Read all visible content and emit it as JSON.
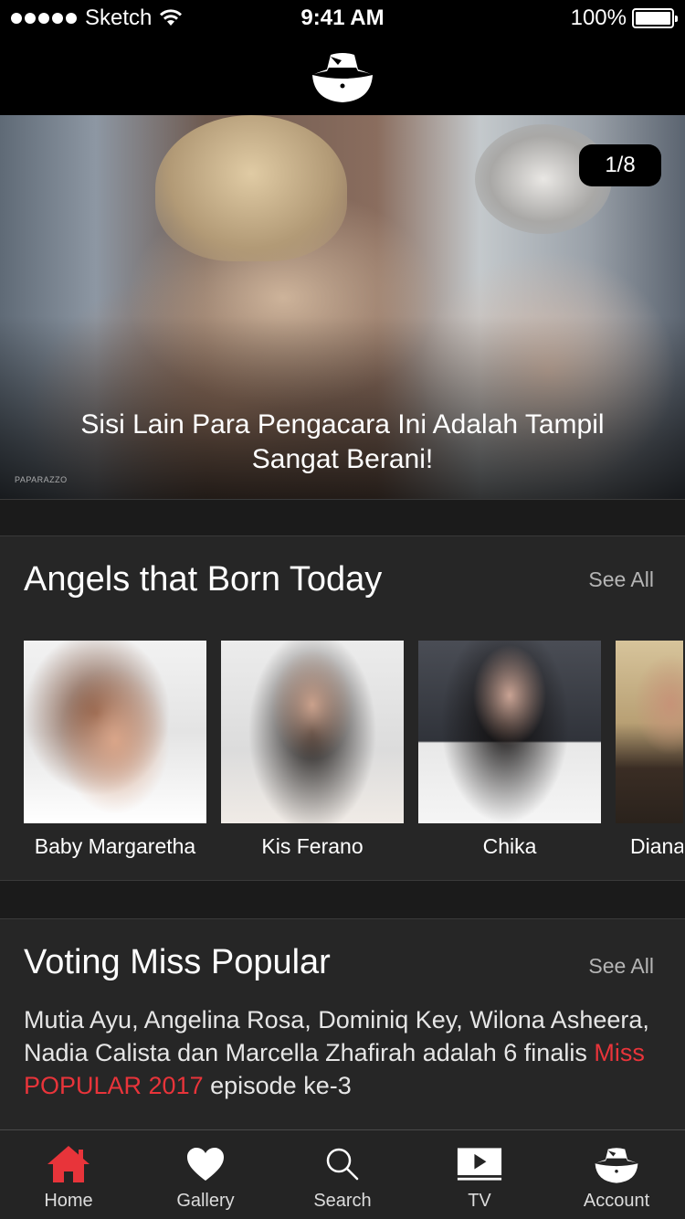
{
  "status_bar": {
    "carrier": "Sketch",
    "time": "9:41 AM",
    "battery": "100%"
  },
  "header": {
    "logo_icon": "hat-logo-icon"
  },
  "hero": {
    "counter": "1/8",
    "title": "Sisi Lain Para Pengacara Ini Adalah Tampil Sangat Berani!",
    "watermark": "PAPARAZZO"
  },
  "angels": {
    "title": "Angels that Born Today",
    "see_all": "See All",
    "items": [
      {
        "name": "Baby Margaretha"
      },
      {
        "name": "Kis Ferano"
      },
      {
        "name": "Chika"
      },
      {
        "name": "Diana"
      }
    ]
  },
  "voting": {
    "title": "Voting Miss Popular",
    "see_all": "See All",
    "text_before": "Mutia Ayu, Angelina Rosa, Dominiq Key, Wilona Asheera, Nadia Calista dan Marcella Zhafirah adalah 6 finalis ",
    "highlight": "Miss POPULAR 2017",
    "text_after": " episode ke-3"
  },
  "tabs": [
    {
      "label": "Home",
      "icon": "home-icon",
      "active": true
    },
    {
      "label": "Gallery",
      "icon": "heart-icon",
      "active": false
    },
    {
      "label": "Search",
      "icon": "search-icon",
      "active": false
    },
    {
      "label": "TV",
      "icon": "play-tv-icon",
      "active": false
    },
    {
      "label": "Account",
      "icon": "hat-account-icon",
      "active": false
    }
  ],
  "colors": {
    "accent": "#e8343a",
    "background": "#1f1f1f",
    "card": "#262626"
  }
}
